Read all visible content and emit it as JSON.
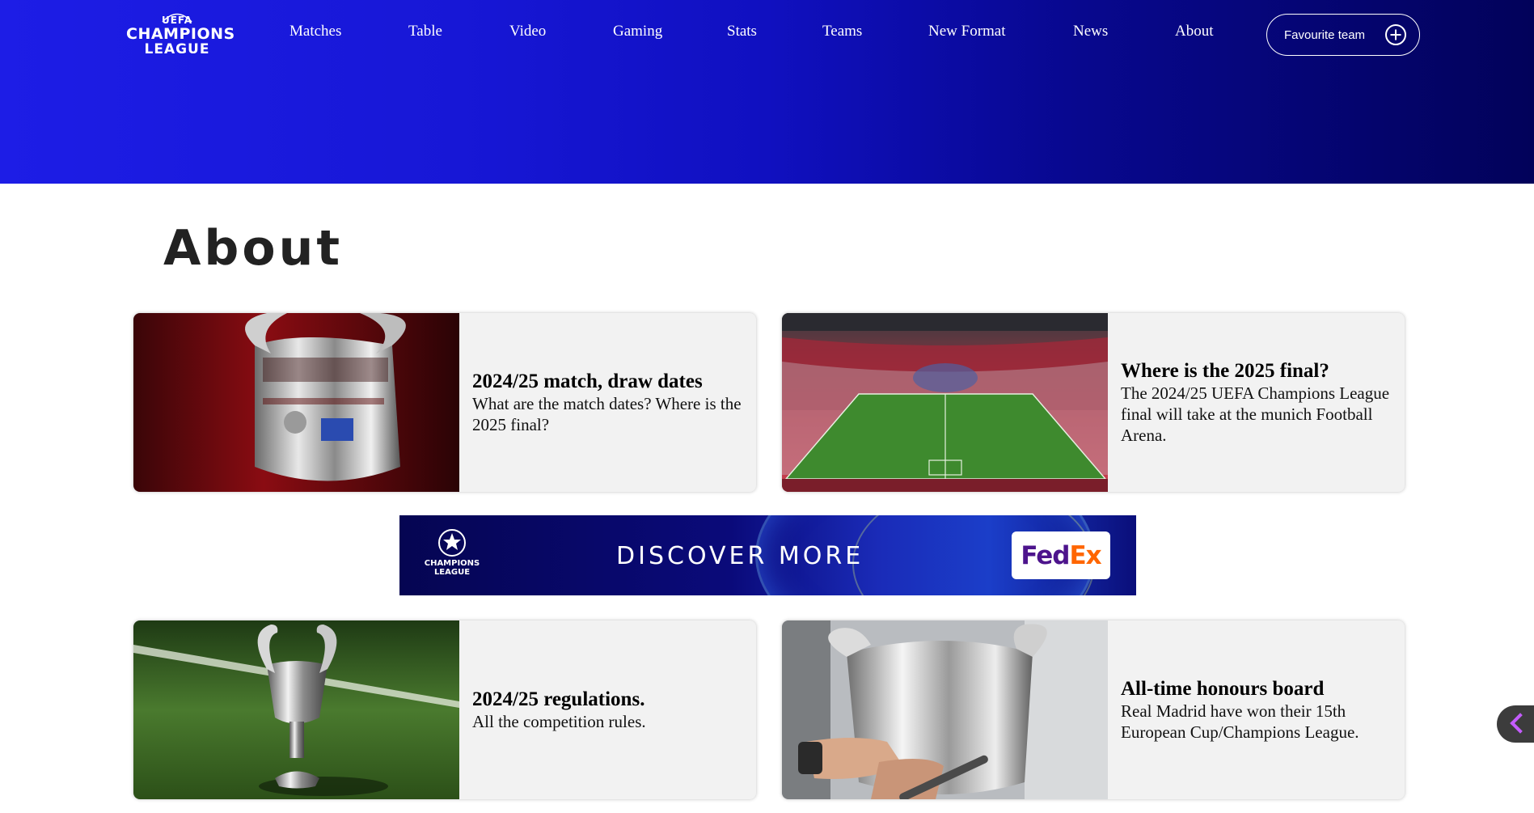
{
  "header": {
    "logo": {
      "line1": "UEFA",
      "line2": "CHAMPIONS",
      "line3": "LEAGUE"
    },
    "nav": [
      "Matches",
      "Table",
      "Video",
      "Gaming",
      "Stats",
      "Teams",
      "New Format",
      "News",
      "About"
    ],
    "favourite_button": "Favourite team",
    "colors": {
      "gradient_start": "#1d1de6",
      "gradient_end": "#02025a"
    }
  },
  "page": {
    "title": "About"
  },
  "cards": [
    {
      "heading": "2024/25 match, draw dates",
      "description": "What are the match dates? Where is the 2025 final?",
      "image": "trophy-closeup"
    },
    {
      "heading": "Where is the 2025 final?",
      "description": "The 2024/25 UEFA Champions League final will take at the munich Football Arena.",
      "image": "munich-stadium"
    },
    {
      "heading": "2024/25 regulations.",
      "description": "All the competition rules.",
      "image": "trophy-on-grass"
    },
    {
      "heading": "All-time honours board",
      "description": "Real Madrid have won their 15th European Cup/Champions League.",
      "image": "trophy-engraving"
    }
  ],
  "banner": {
    "logo_line1": "CHAMPIONS",
    "logo_line2": "LEAGUE",
    "text": "DISCOVER MORE",
    "sponsor_part1": "Fed",
    "sponsor_part2": "Ex"
  }
}
